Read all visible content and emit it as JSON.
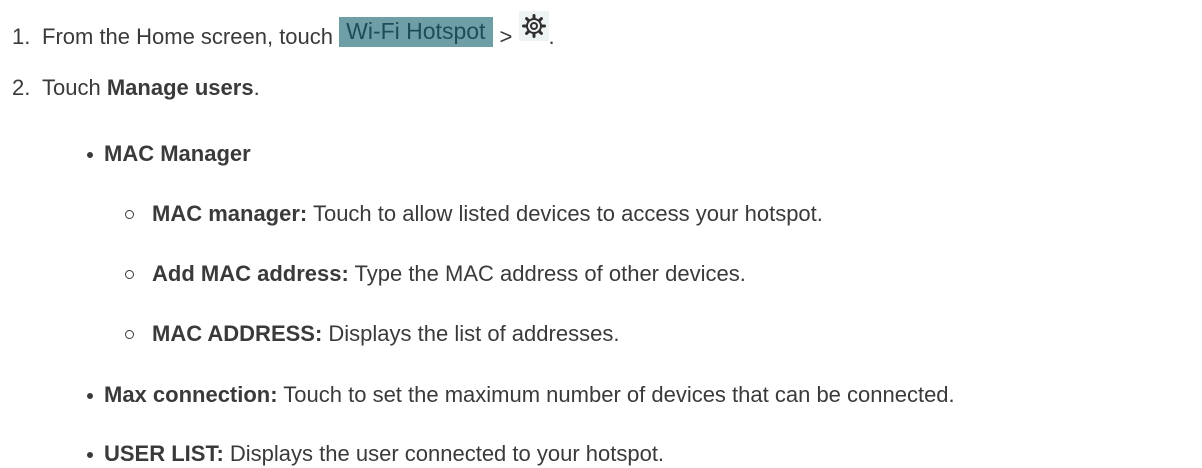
{
  "steps": [
    {
      "number": "1.",
      "text_before": "From the Home screen, touch ",
      "button_label": "Wi-Fi Hotspot",
      "separator": " > ",
      "icon": "gear-icon",
      "end": "."
    },
    {
      "number": "2.",
      "text_before": "Touch ",
      "bold": "Manage users",
      "end": "."
    }
  ],
  "bullets": [
    {
      "title": "MAC Manager",
      "sub_items": [
        {
          "term": "MAC manager:",
          "desc": " Touch to allow listed devices to access your hotspot."
        },
        {
          "term": "Add MAC address:",
          "desc": " Type the MAC address of other devices."
        },
        {
          "term": "MAC ADDRESS:",
          "desc": " Displays the list of addresses."
        }
      ]
    },
    {
      "term": "Max connection:",
      "desc": "  Touch to set the maximum number of devices that can be connected."
    },
    {
      "term": "USER LIST:",
      "desc": " Displays the user connected to your hotspot."
    }
  ],
  "colors": {
    "text": "#3a3a3a",
    "button_bg": "#6e9fa7",
    "button_text": "#1f4d57"
  }
}
